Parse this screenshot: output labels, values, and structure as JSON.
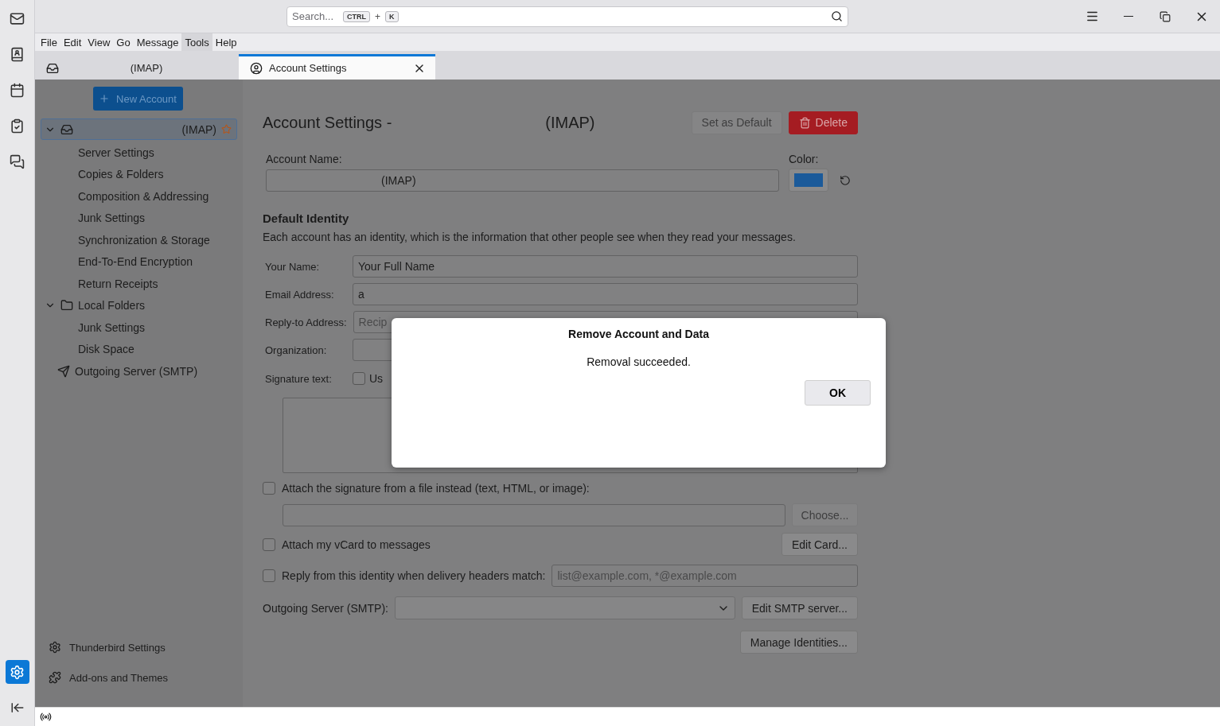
{
  "search": {
    "placeholder": "Search...",
    "keys": [
      "CTRL",
      "K"
    ],
    "separator": "+"
  },
  "menu": [
    {
      "label": "File",
      "selected": false
    },
    {
      "label": "Edit",
      "selected": false
    },
    {
      "label": "View",
      "selected": false
    },
    {
      "label": "Go",
      "selected": false
    },
    {
      "label": "Message",
      "selected": false
    },
    {
      "label": "Tools",
      "selected": true
    },
    {
      "label": "Help",
      "selected": false
    }
  ],
  "tabs": [
    {
      "label": "(IMAP)",
      "kind": "mail",
      "selected": false,
      "closable": false
    },
    {
      "label": "Account Settings",
      "kind": "settings",
      "selected": true,
      "closable": true
    }
  ],
  "spaces": [
    {
      "kind": "mail",
      "selected": false
    },
    {
      "kind": "contacts",
      "selected": false
    },
    {
      "kind": "calendar",
      "selected": false
    },
    {
      "kind": "tasks",
      "selected": false
    },
    {
      "kind": "chat",
      "selected": false
    }
  ],
  "spaces_settings": {
    "selected": true
  },
  "account_tree": {
    "new_account": "New Account",
    "items": [
      {
        "label": "(IMAP)",
        "kind": "account",
        "expanded": true,
        "selected": true,
        "default": true,
        "children": [
          {
            "label": "Server Settings",
            "selected": false
          },
          {
            "label": "Copies & Folders",
            "selected": false
          },
          {
            "label": "Composition & Addressing",
            "selected": false
          },
          {
            "label": "Junk Settings",
            "selected": false
          },
          {
            "label": "Synchronization & Storage",
            "selected": false
          },
          {
            "label": "End-To-End Encryption",
            "selected": false
          },
          {
            "label": "Return Receipts",
            "selected": false
          }
        ]
      },
      {
        "label": "Local Folders",
        "kind": "folder",
        "expanded": true,
        "selected": false,
        "default": false,
        "children": [
          {
            "label": "Junk Settings",
            "selected": false
          },
          {
            "label": "Disk Space",
            "selected": false
          }
        ]
      },
      {
        "label": "Outgoing Server (SMTP)",
        "kind": "smtp",
        "selected": false,
        "default": false
      }
    ],
    "footer": [
      {
        "label": "Thunderbird Settings",
        "kind": "settings"
      },
      {
        "label": "Add-ons and Themes",
        "kind": "addons"
      }
    ]
  },
  "settings": {
    "title": "Account Settings -",
    "title_suffix": "(IMAP)",
    "set_default": {
      "label": "Set as Default",
      "disabled": true
    },
    "delete": {
      "label": "Delete"
    },
    "account_name": {
      "label": "Account Name:",
      "value": "(IMAP)"
    },
    "account_color": {
      "label": "Color:"
    },
    "identity_heading": "Default Identity",
    "identity_description": "Each account has an identity, which is the information that other people see when they read your messages.",
    "fields": [
      {
        "label": "Your Name:",
        "value": "Your Full Name"
      },
      {
        "label": "Email Address:",
        "value": "a"
      },
      {
        "label": "Reply-to Address:",
        "placeholder": "Recip"
      },
      {
        "label": "Organization:"
      }
    ],
    "signature": {
      "label": "Signature text:",
      "checkbox_label": "Us",
      "checked": false
    },
    "attach_signature": {
      "label": "Attach the signature from a file instead (text, HTML, or image):",
      "checked": false,
      "button": "Choose...",
      "button_disabled": true
    },
    "vcard": {
      "label": "Attach my vCard to messages",
      "checked": false,
      "button": "Edit Card..."
    },
    "reply_from": {
      "label": "Reply from this identity when delivery headers match:",
      "checked": false,
      "placeholder": "list@example.com, *@example.com"
    },
    "smtp": {
      "label": "Outgoing Server (SMTP):",
      "button": "Edit SMTP server..."
    },
    "manage": "Manage Identities..."
  },
  "dialog": {
    "title": "Remove Account and Data",
    "message": "Removal succeeded.",
    "button": "OK"
  }
}
